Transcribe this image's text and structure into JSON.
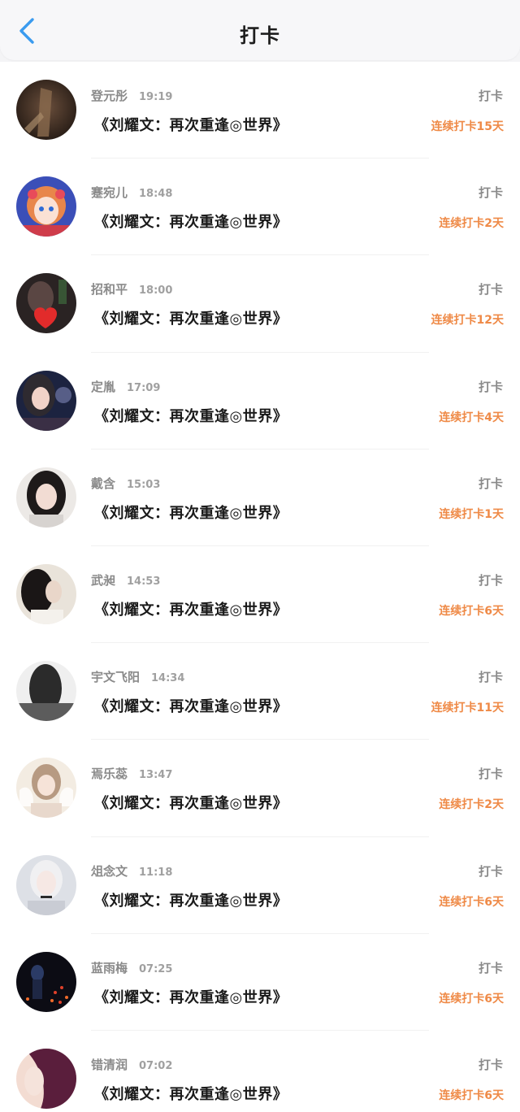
{
  "header": {
    "title": "打卡"
  },
  "colors": {
    "accent": "#3a9bef",
    "streak": "#ef8a47",
    "muted_text": "#8a8a8a"
  },
  "entries": [
    {
      "name": "登元彤",
      "time": "19:19",
      "book": "《刘耀文：再次重逢◎世界》",
      "action": "打卡",
      "streak": "连续打卡15天"
    },
    {
      "name": "蹇宛儿",
      "time": "18:48",
      "book": "《刘耀文：再次重逢◎世界》",
      "action": "打卡",
      "streak": "连续打卡2天"
    },
    {
      "name": "招和平",
      "time": "18:00",
      "book": "《刘耀文：再次重逢◎世界》",
      "action": "打卡",
      "streak": "连续打卡12天"
    },
    {
      "name": "定胤",
      "time": "17:09",
      "book": "《刘耀文：再次重逢◎世界》",
      "action": "打卡",
      "streak": "连续打卡4天"
    },
    {
      "name": "戴含",
      "time": "15:03",
      "book": "《刘耀文：再次重逢◎世界》",
      "action": "打卡",
      "streak": "连续打卡1天"
    },
    {
      "name": "武昶",
      "time": "14:53",
      "book": "《刘耀文：再次重逢◎世界》",
      "action": "打卡",
      "streak": "连续打卡6天"
    },
    {
      "name": "宇文飞阳",
      "time": "14:34",
      "book": "《刘耀文：再次重逢◎世界》",
      "action": "打卡",
      "streak": "连续打卡11天"
    },
    {
      "name": "焉乐蕊",
      "time": "13:47",
      "book": "《刘耀文：再次重逢◎世界》",
      "action": "打卡",
      "streak": "连续打卡2天"
    },
    {
      "name": "俎念文",
      "time": "11:18",
      "book": "《刘耀文：再次重逢◎世界》",
      "action": "打卡",
      "streak": "连续打卡6天"
    },
    {
      "name": "蓝雨梅",
      "time": "07:25",
      "book": "《刘耀文：再次重逢◎世界》",
      "action": "打卡",
      "streak": "连续打卡6天"
    },
    {
      "name": "错清润",
      "time": "07:02",
      "book": "《刘耀文：再次重逢◎世界》",
      "action": "打卡",
      "streak": "连续打卡6天"
    }
  ]
}
